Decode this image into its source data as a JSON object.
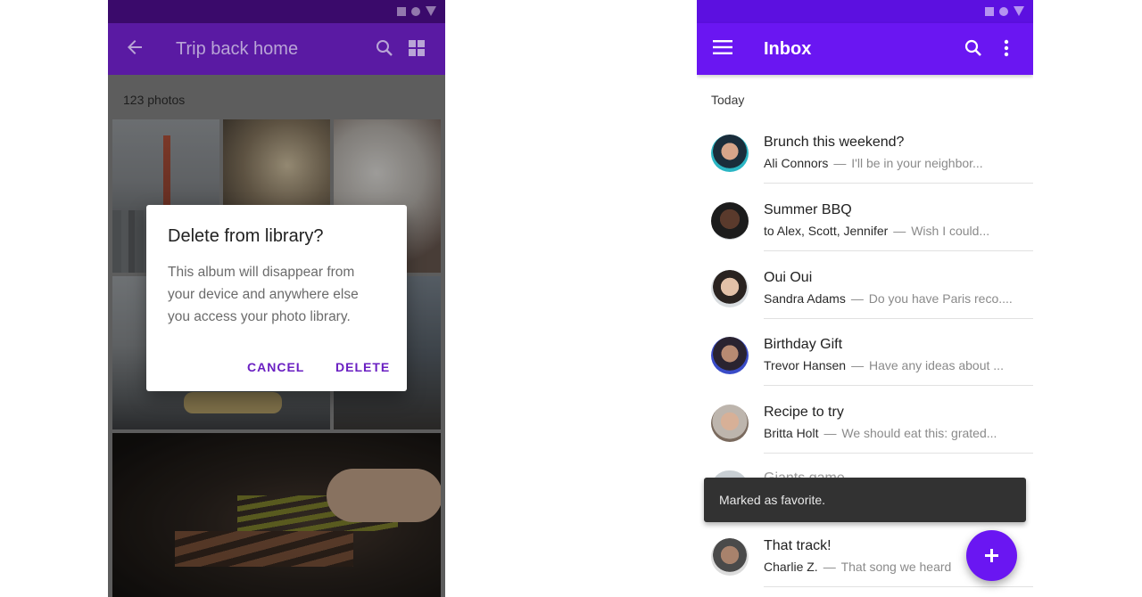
{
  "left_screen": {
    "appbar": {
      "title": "Trip back home",
      "icons": [
        "arrow-back-icon",
        "search-icon",
        "grid-view-icon"
      ],
      "color": "#5a1aa3"
    },
    "photo_count": "123 photos",
    "dialog": {
      "title": "Delete from library?",
      "body_lines": [
        "This album will disappear from",
        "your device and anywhere else",
        "you access your photo library."
      ],
      "cancel_label": "CANCEL",
      "delete_label": "DELETE",
      "accent": "#6a1fc2"
    }
  },
  "right_screen": {
    "appbar": {
      "title": "Inbox",
      "icons": [
        "menu-icon",
        "search-icon",
        "more-vert-icon"
      ],
      "color": "#6a16f2"
    },
    "section_header": "Today",
    "messages": [
      {
        "subject": "Brunch this weekend?",
        "sender": "Ali Connors",
        "preview": "I'll be in your neighbor..."
      },
      {
        "subject": "Summer BBQ",
        "sender": "to Alex, Scott, Jennifer",
        "preview": "Wish I could..."
      },
      {
        "subject": "Oui Oui",
        "sender": "Sandra Adams",
        "preview": "Do you have Paris reco...."
      },
      {
        "subject": "Birthday Gift",
        "sender": "Trevor Hansen",
        "preview": "Have any ideas about ..."
      },
      {
        "subject": "Recipe to try",
        "sender": "Britta Holt",
        "preview": "We should eat this: grated..."
      },
      {
        "subject": "Giants game",
        "sender": "",
        "preview": ""
      },
      {
        "subject": "That track!",
        "sender": "Charlie Z.",
        "preview": "That song we heard"
      }
    ],
    "snackbar": {
      "text": "Marked as favorite."
    },
    "fab": {
      "icon": "add-icon"
    },
    "dash": "—"
  }
}
